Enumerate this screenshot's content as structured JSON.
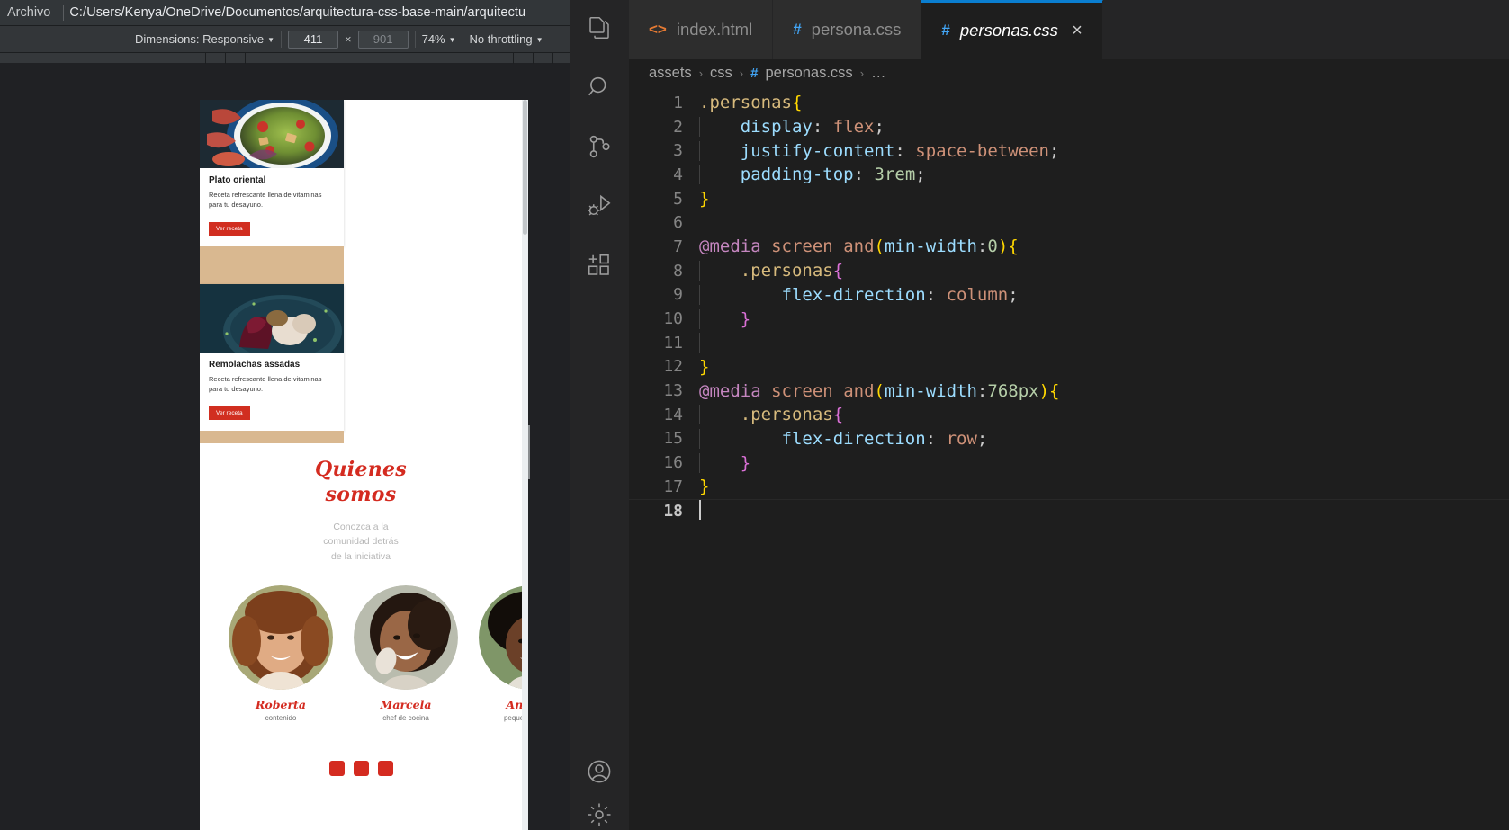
{
  "browser": {
    "menu": {
      "archivo": "Archivo"
    },
    "url": "C:/Users/Kenya/OneDrive/Documentos/arquitectura-css-base-main/arquitectu",
    "devtools": {
      "dimensions_label": "Dimensions: Responsive",
      "width_value": "411",
      "height_placeholder": "901",
      "times": "×",
      "zoom": "74%",
      "throttling": "No throttling"
    },
    "page": {
      "cards": [
        {
          "title": "Plato oriental",
          "text": "Receta refrescante llena de vitaminas para tu desayuno.",
          "button": "Ver receta"
        },
        {
          "title": "Remolachas assadas",
          "text": "Receta refrescante llena de vitaminas para tu desayuno.",
          "button": "Ver receta"
        }
      ],
      "quienes": {
        "title_line1": "Quienes",
        "title_line2": "somos",
        "subtitle_line1": "Conozca a la",
        "subtitle_line2": "comunidad detrás",
        "subtitle_line3": "de la iniciativa"
      },
      "personas": [
        {
          "name": "Roberta",
          "role": "contenido"
        },
        {
          "name": "Marcela",
          "role": "chef de cocina"
        },
        {
          "name": "Andréia",
          "role": "pequeña product"
        }
      ]
    }
  },
  "vscode": {
    "activitybar": {
      "items": [
        {
          "icon": "explorer-icon"
        },
        {
          "icon": "search-icon"
        },
        {
          "icon": "source-control-icon"
        },
        {
          "icon": "run-and-debug-icon"
        },
        {
          "icon": "extensions-icon"
        }
      ],
      "bottom": [
        {
          "icon": "account-icon"
        },
        {
          "icon": "settings-gear-icon"
        }
      ]
    },
    "tabs": [
      {
        "label": "index.html",
        "icon": "html-file-icon",
        "icon_glyph": "<>",
        "active": false,
        "closable": false
      },
      {
        "label": "persona.css",
        "icon": "css-file-icon",
        "icon_glyph": "#",
        "active": false,
        "closable": false
      },
      {
        "label": "personas.css",
        "icon": "css-file-icon",
        "icon_glyph": "#",
        "active": true,
        "closable": true
      }
    ],
    "tab_close_glyph": "×",
    "breadcrumb": {
      "parts": [
        "assets",
        "css",
        "personas.css",
        "…"
      ],
      "sep": "›",
      "css_glyph": "#"
    },
    "editor": {
      "lines": [
        {
          "no": "1",
          "text": ".personas{"
        },
        {
          "no": "2",
          "text": "    display: flex;"
        },
        {
          "no": "3",
          "text": "    justify-content: space-between;"
        },
        {
          "no": "4",
          "text": "    padding-top: 3rem;"
        },
        {
          "no": "5",
          "text": "}"
        },
        {
          "no": "6",
          "text": ""
        },
        {
          "no": "7",
          "text": "@media screen and(min-width:0){"
        },
        {
          "no": "8",
          "text": "    .personas{"
        },
        {
          "no": "9",
          "text": "        flex-direction: column;"
        },
        {
          "no": "10",
          "text": "    }"
        },
        {
          "no": "11",
          "text": ""
        },
        {
          "no": "12",
          "text": "}"
        },
        {
          "no": "13",
          "text": "@media screen and(min-width:768px){"
        },
        {
          "no": "14",
          "text": "    .personas{"
        },
        {
          "no": "15",
          "text": "        flex-direction: row;"
        },
        {
          "no": "16",
          "text": "    }"
        },
        {
          "no": "17",
          "text": "}"
        },
        {
          "no": "18",
          "text": ""
        }
      ]
    },
    "colors": {
      "accent": "#0a7ed0",
      "editor_bg": "#1e1e1e",
      "chrome_bg": "#252526",
      "selector": "#d7ba7d",
      "property": "#9cdcfe",
      "value": "#ce9178",
      "number": "#b5cea8",
      "atrule": "#c586c0"
    }
  }
}
